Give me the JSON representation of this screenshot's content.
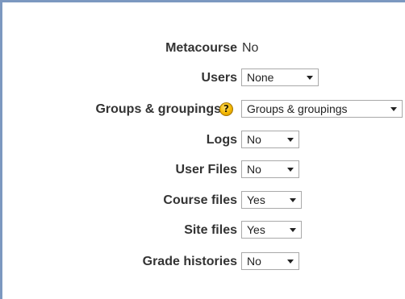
{
  "form": {
    "metacourse": {
      "label": "Metacourse",
      "value": "No"
    },
    "users": {
      "label": "Users",
      "selected": "None"
    },
    "groups": {
      "label": "Groups & groupings",
      "help_icon": "help-question-icon",
      "selected": "Groups & groupings"
    },
    "logs": {
      "label": "Logs",
      "selected": "No"
    },
    "user_files": {
      "label": "User Files",
      "selected": "No"
    },
    "course_files": {
      "label": "Course files",
      "selected": "Yes"
    },
    "site_files": {
      "label": "Site files",
      "selected": "Yes"
    },
    "grade_histories": {
      "label": "Grade histories",
      "selected": "No"
    }
  },
  "colors": {
    "frame_border": "#7c98c0",
    "help_icon": "#f5b800"
  }
}
